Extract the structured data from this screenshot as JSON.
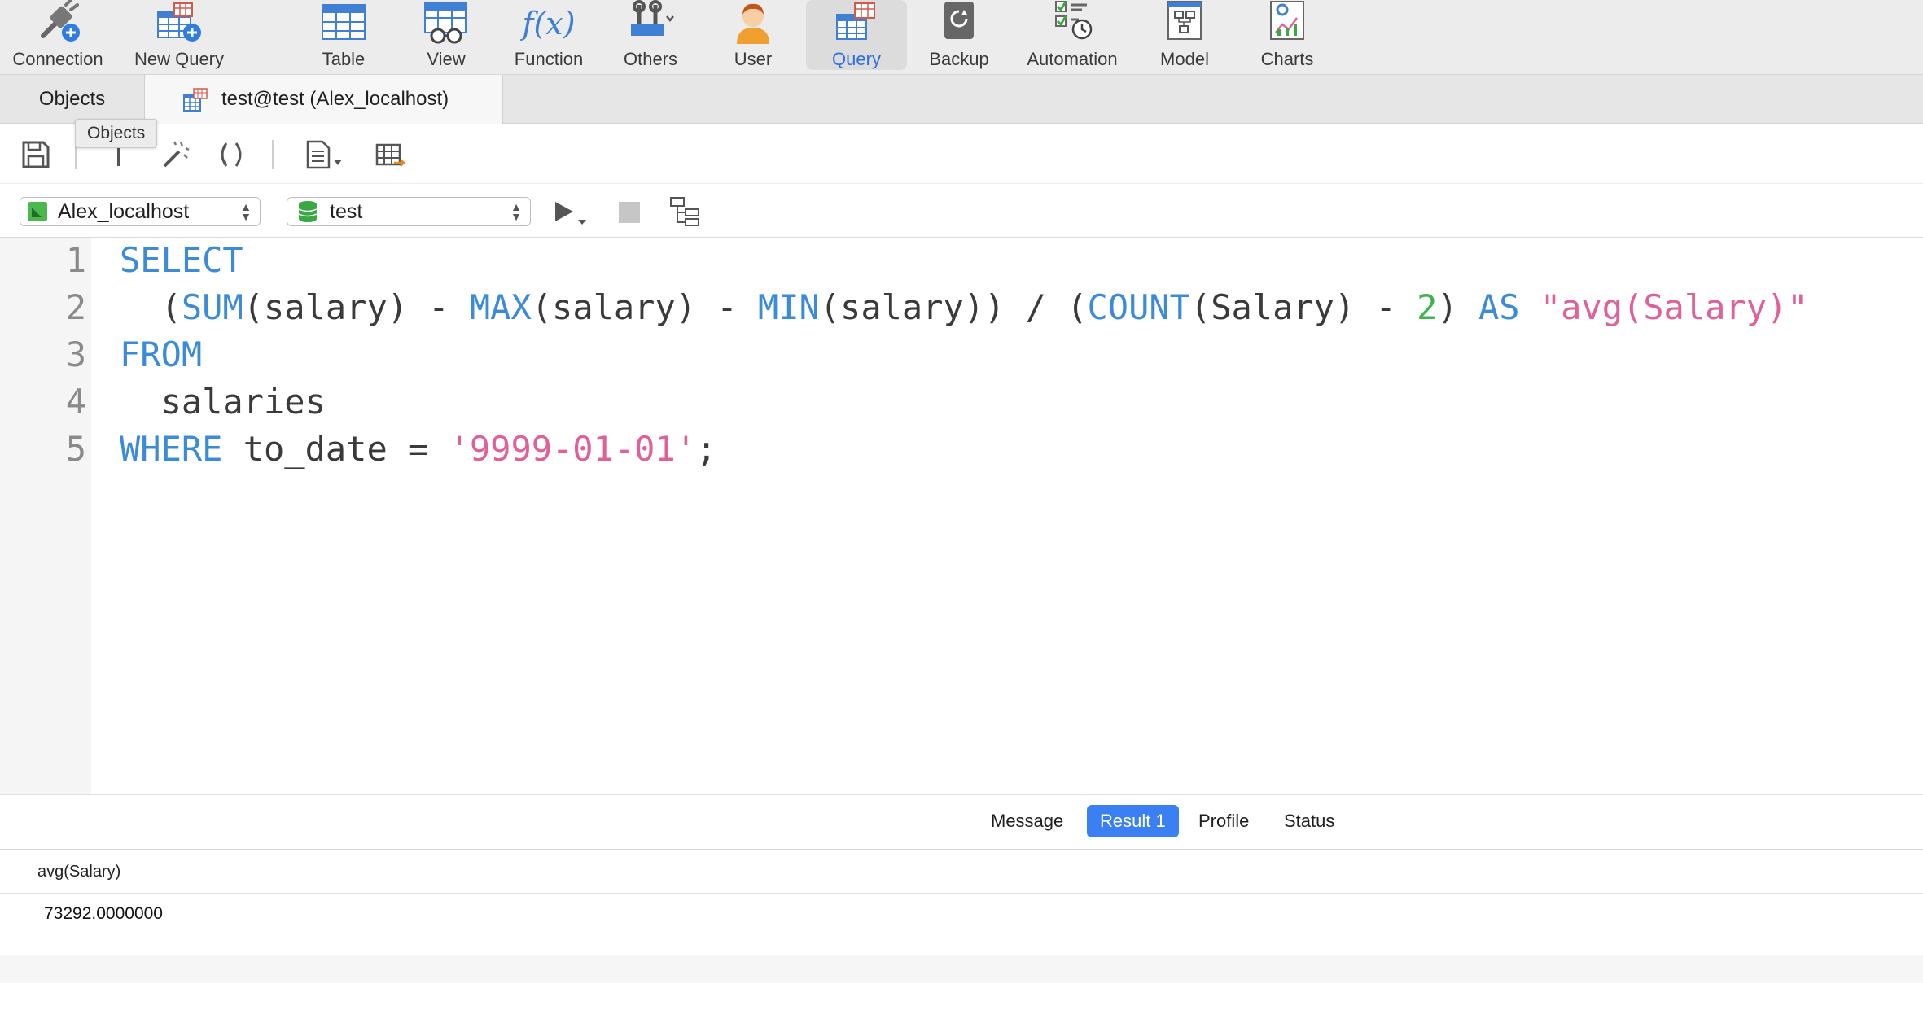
{
  "toolbar": {
    "items": [
      {
        "label": "Connection",
        "icon": "connection-plug-icon"
      },
      {
        "label": "New Query",
        "icon": "new-query-icon"
      },
      {
        "label": "Table",
        "icon": "table-icon"
      },
      {
        "label": "View",
        "icon": "view-icon"
      },
      {
        "label": "Function",
        "icon": "function-icon"
      },
      {
        "label": "Others",
        "icon": "others-tools-icon"
      },
      {
        "label": "User",
        "icon": "user-icon"
      },
      {
        "label": "Query",
        "icon": "query-icon",
        "active": true
      },
      {
        "label": "Backup",
        "icon": "backup-icon"
      },
      {
        "label": "Automation",
        "icon": "automation-icon"
      },
      {
        "label": "Model",
        "icon": "model-icon"
      },
      {
        "label": "Charts",
        "icon": "charts-icon"
      }
    ],
    "function_glyph": "f(x)"
  },
  "tabs": {
    "objects": "Objects",
    "query": "test@test (Alex_localhost)"
  },
  "tooltip": "Objects",
  "connection": {
    "server": "Alex_localhost",
    "database": "test"
  },
  "editor": {
    "line_numbers": [
      "1",
      "2",
      "3",
      "4",
      "5"
    ],
    "lines": {
      "l1": {
        "kw": "SELECT"
      },
      "l2": {
        "indent": "  ",
        "p1": "(",
        "sum": "SUM",
        "p2": "(salary) - ",
        "max": "MAX",
        "p3": "(salary) - ",
        "min": "MIN",
        "p4": "(salary)) / (",
        "count": "COUNT",
        "p5": "(Salary) - ",
        "two": "2",
        "p6": ") ",
        "as": "AS",
        "p7": " ",
        "alias": "\"avg(Salary)\""
      },
      "l3": {
        "kw": "FROM"
      },
      "l4": {
        "text": "  salaries"
      },
      "l5": {
        "kw": "WHERE",
        "p1": " to_date = ",
        "str": "'9999-01-01'",
        "p2": ";"
      }
    }
  },
  "results": {
    "tabs": [
      "Message",
      "Result 1",
      "Profile",
      "Status"
    ],
    "active_tab": "Result 1",
    "column": "avg(Salary)",
    "rows": [
      "73292.0000000"
    ]
  },
  "colors": {
    "keyword": "#3b8bd8",
    "string": "#e0609a",
    "number": "#3fb350",
    "active_tab": "#3a80f2"
  }
}
